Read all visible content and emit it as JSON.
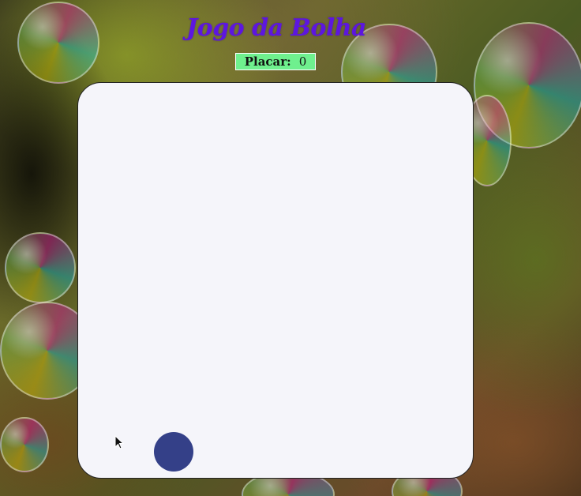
{
  "game": {
    "title": "Jogo da Bolha",
    "score_label": "Placar:",
    "score_value": "0"
  },
  "colors": {
    "title": "#5d16e0",
    "score_background": "#6ff08e",
    "game_area_background": "#f5f5fa",
    "player_bubble": "#344088"
  },
  "icons": {
    "cursor": "mouse-pointer-icon"
  }
}
